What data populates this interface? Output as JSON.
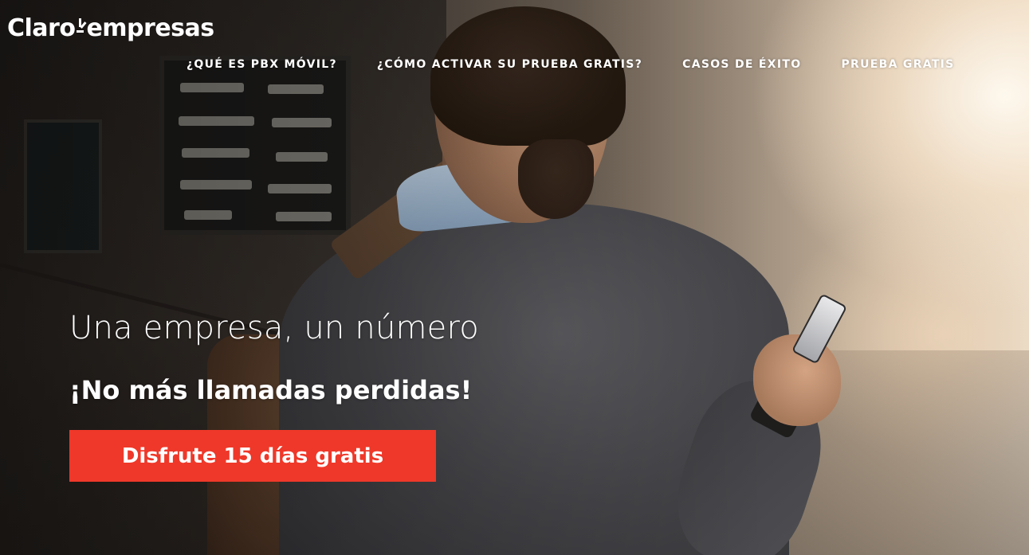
{
  "brand": {
    "logo_left": "Claro",
    "logo_right": "empresas",
    "accent_color": "#ef3829"
  },
  "nav": {
    "items": [
      {
        "label": "¿QUÉ ES PBX MÓVIL?"
      },
      {
        "label": "¿CÓMO ACTIVAR SU PRUEBA GRATIS?"
      },
      {
        "label": "CASOS DE ÉXITO"
      },
      {
        "label": "PRUEBA GRATIS"
      }
    ]
  },
  "hero": {
    "headline": "Una empresa, un número",
    "subheadline": "¡No más llamadas perdidas!",
    "cta_label": "Disfrute 15 días gratis",
    "background_image": "man-with-backpack-using-phone-icon"
  }
}
